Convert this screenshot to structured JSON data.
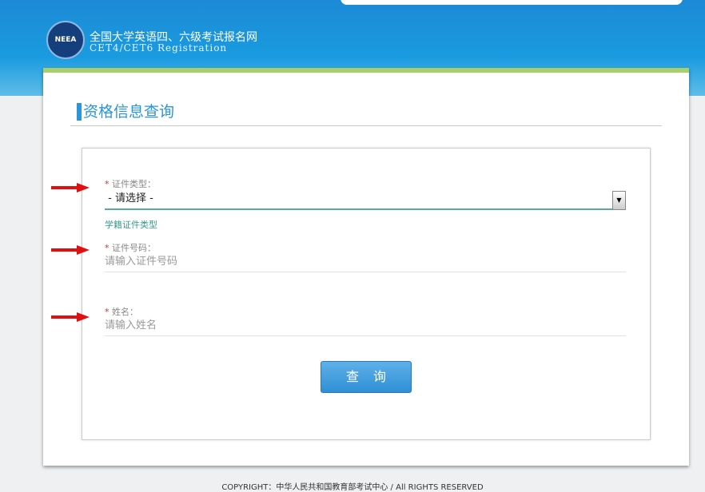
{
  "header": {
    "logo_text": "NEEA",
    "title_cn": "全国大学英语四、六级考试报名网",
    "title_en": "CET4/CET6   Registration"
  },
  "page": {
    "title": "资格信息查询"
  },
  "form": {
    "id_type": {
      "label": "证件类型：",
      "value": "- 请选择 -",
      "hint": "学籍证件类型"
    },
    "id_number": {
      "label": "证件号码：",
      "placeholder": "请输入证件号码"
    },
    "name": {
      "label": "姓名：",
      "placeholder": "请输入姓名"
    },
    "required_mark": "*",
    "submit": "查询"
  },
  "annotation_color": "#e01010",
  "footer": "COPYRIGHT：中华人民共和国教育部考试中心 / All RIGHTS RESERVED"
}
